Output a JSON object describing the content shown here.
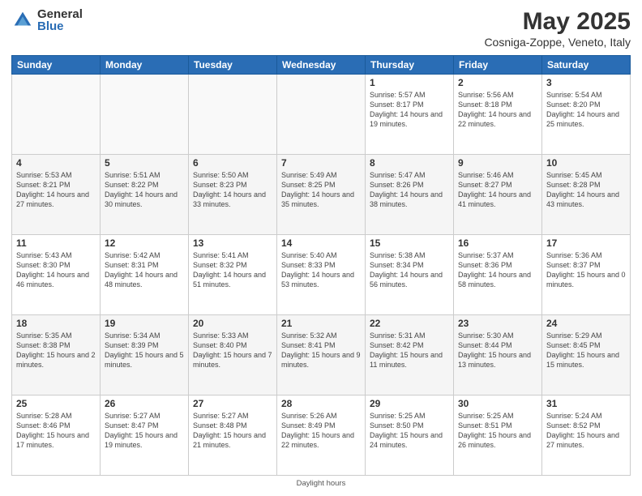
{
  "logo": {
    "general": "General",
    "blue": "Blue"
  },
  "title": "May 2025",
  "subtitle": "Cosniga-Zoppe, Veneto, Italy",
  "days": [
    "Sunday",
    "Monday",
    "Tuesday",
    "Wednesday",
    "Thursday",
    "Friday",
    "Saturday"
  ],
  "weeks": [
    [
      {
        "date": "",
        "info": ""
      },
      {
        "date": "",
        "info": ""
      },
      {
        "date": "",
        "info": ""
      },
      {
        "date": "",
        "info": ""
      },
      {
        "date": "1",
        "info": "Sunrise: 5:57 AM\nSunset: 8:17 PM\nDaylight: 14 hours\nand 19 minutes."
      },
      {
        "date": "2",
        "info": "Sunrise: 5:56 AM\nSunset: 8:18 PM\nDaylight: 14 hours\nand 22 minutes."
      },
      {
        "date": "3",
        "info": "Sunrise: 5:54 AM\nSunset: 8:20 PM\nDaylight: 14 hours\nand 25 minutes."
      }
    ],
    [
      {
        "date": "4",
        "info": "Sunrise: 5:53 AM\nSunset: 8:21 PM\nDaylight: 14 hours\nand 27 minutes."
      },
      {
        "date": "5",
        "info": "Sunrise: 5:51 AM\nSunset: 8:22 PM\nDaylight: 14 hours\nand 30 minutes."
      },
      {
        "date": "6",
        "info": "Sunrise: 5:50 AM\nSunset: 8:23 PM\nDaylight: 14 hours\nand 33 minutes."
      },
      {
        "date": "7",
        "info": "Sunrise: 5:49 AM\nSunset: 8:25 PM\nDaylight: 14 hours\nand 35 minutes."
      },
      {
        "date": "8",
        "info": "Sunrise: 5:47 AM\nSunset: 8:26 PM\nDaylight: 14 hours\nand 38 minutes."
      },
      {
        "date": "9",
        "info": "Sunrise: 5:46 AM\nSunset: 8:27 PM\nDaylight: 14 hours\nand 41 minutes."
      },
      {
        "date": "10",
        "info": "Sunrise: 5:45 AM\nSunset: 8:28 PM\nDaylight: 14 hours\nand 43 minutes."
      }
    ],
    [
      {
        "date": "11",
        "info": "Sunrise: 5:43 AM\nSunset: 8:30 PM\nDaylight: 14 hours\nand 46 minutes."
      },
      {
        "date": "12",
        "info": "Sunrise: 5:42 AM\nSunset: 8:31 PM\nDaylight: 14 hours\nand 48 minutes."
      },
      {
        "date": "13",
        "info": "Sunrise: 5:41 AM\nSunset: 8:32 PM\nDaylight: 14 hours\nand 51 minutes."
      },
      {
        "date": "14",
        "info": "Sunrise: 5:40 AM\nSunset: 8:33 PM\nDaylight: 14 hours\nand 53 minutes."
      },
      {
        "date": "15",
        "info": "Sunrise: 5:38 AM\nSunset: 8:34 PM\nDaylight: 14 hours\nand 56 minutes."
      },
      {
        "date": "16",
        "info": "Sunrise: 5:37 AM\nSunset: 8:36 PM\nDaylight: 14 hours\nand 58 minutes."
      },
      {
        "date": "17",
        "info": "Sunrise: 5:36 AM\nSunset: 8:37 PM\nDaylight: 15 hours\nand 0 minutes."
      }
    ],
    [
      {
        "date": "18",
        "info": "Sunrise: 5:35 AM\nSunset: 8:38 PM\nDaylight: 15 hours\nand 2 minutes."
      },
      {
        "date": "19",
        "info": "Sunrise: 5:34 AM\nSunset: 8:39 PM\nDaylight: 15 hours\nand 5 minutes."
      },
      {
        "date": "20",
        "info": "Sunrise: 5:33 AM\nSunset: 8:40 PM\nDaylight: 15 hours\nand 7 minutes."
      },
      {
        "date": "21",
        "info": "Sunrise: 5:32 AM\nSunset: 8:41 PM\nDaylight: 15 hours\nand 9 minutes."
      },
      {
        "date": "22",
        "info": "Sunrise: 5:31 AM\nSunset: 8:42 PM\nDaylight: 15 hours\nand 11 minutes."
      },
      {
        "date": "23",
        "info": "Sunrise: 5:30 AM\nSunset: 8:44 PM\nDaylight: 15 hours\nand 13 minutes."
      },
      {
        "date": "24",
        "info": "Sunrise: 5:29 AM\nSunset: 8:45 PM\nDaylight: 15 hours\nand 15 minutes."
      }
    ],
    [
      {
        "date": "25",
        "info": "Sunrise: 5:28 AM\nSunset: 8:46 PM\nDaylight: 15 hours\nand 17 minutes."
      },
      {
        "date": "26",
        "info": "Sunrise: 5:27 AM\nSunset: 8:47 PM\nDaylight: 15 hours\nand 19 minutes."
      },
      {
        "date": "27",
        "info": "Sunrise: 5:27 AM\nSunset: 8:48 PM\nDaylight: 15 hours\nand 21 minutes."
      },
      {
        "date": "28",
        "info": "Sunrise: 5:26 AM\nSunset: 8:49 PM\nDaylight: 15 hours\nand 22 minutes."
      },
      {
        "date": "29",
        "info": "Sunrise: 5:25 AM\nSunset: 8:50 PM\nDaylight: 15 hours\nand 24 minutes."
      },
      {
        "date": "30",
        "info": "Sunrise: 5:25 AM\nSunset: 8:51 PM\nDaylight: 15 hours\nand 26 minutes."
      },
      {
        "date": "31",
        "info": "Sunrise: 5:24 AM\nSunset: 8:52 PM\nDaylight: 15 hours\nand 27 minutes."
      }
    ]
  ],
  "footer": "Daylight hours"
}
